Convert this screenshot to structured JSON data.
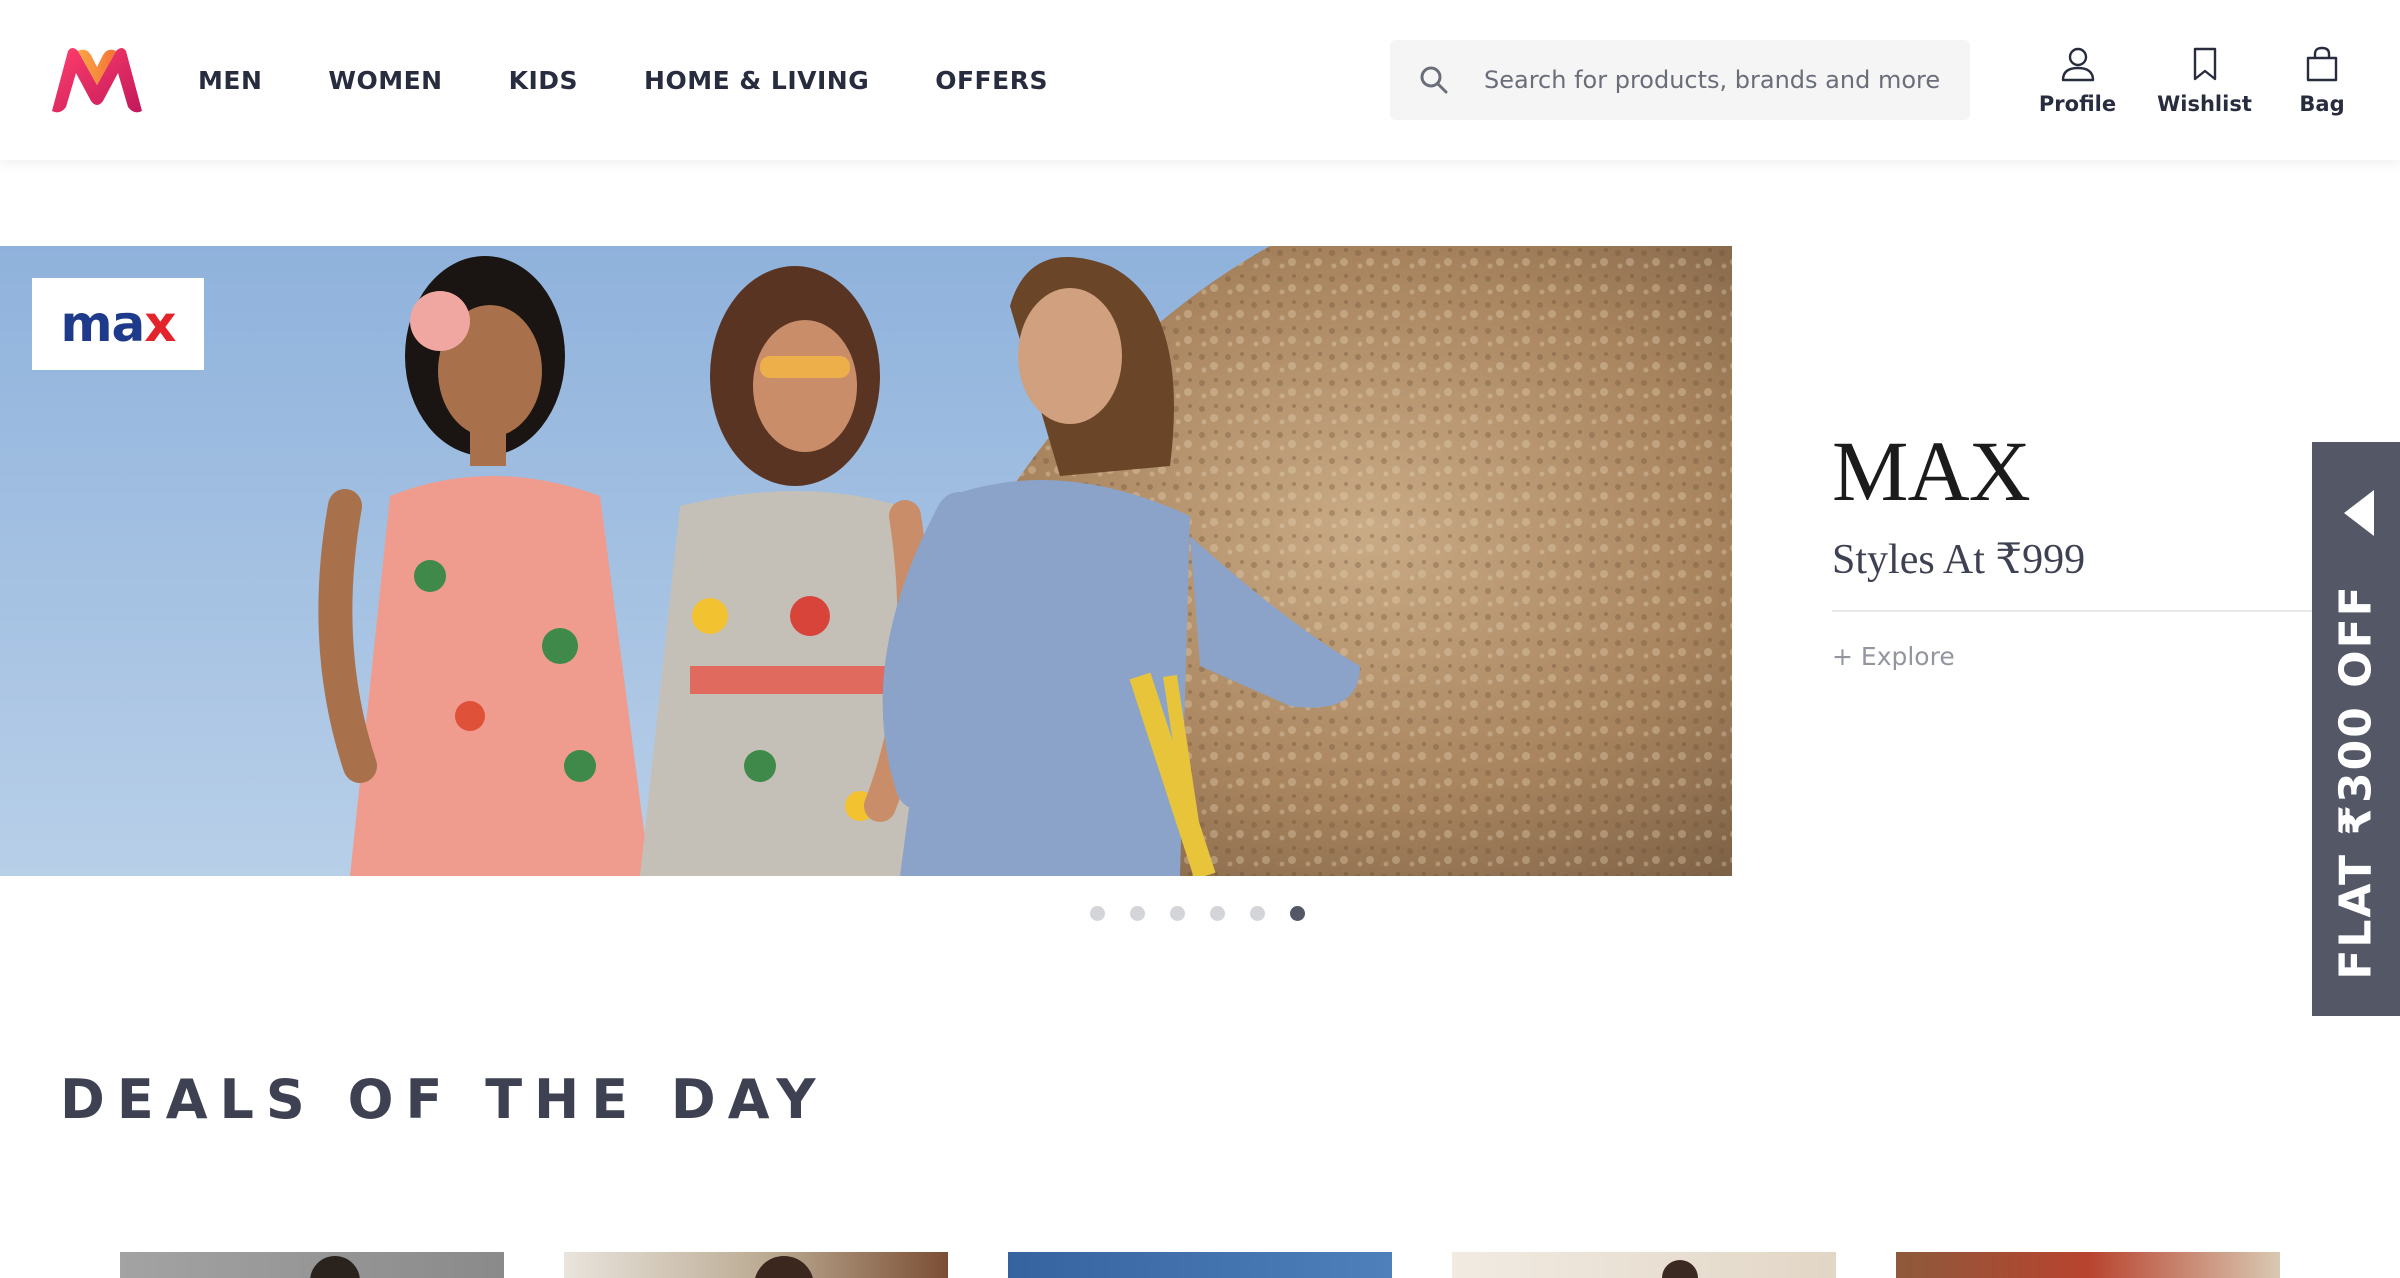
{
  "header": {
    "nav": [
      "MEN",
      "WOMEN",
      "KIDS",
      "HOME & LIVING",
      "OFFERS"
    ],
    "search_placeholder": "Search for products, brands and more",
    "actions": {
      "profile": "Profile",
      "wishlist": "Wishlist",
      "bag": "Bag"
    }
  },
  "banner": {
    "brand_logo_text": "max",
    "title": "MAX",
    "subtitle": "Styles At ₹999",
    "explore": "+ Explore",
    "slides_total": 6,
    "active_slide": 6
  },
  "side_tab": {
    "text": "FLAT ₹300 OFF"
  },
  "deals": {
    "title": "DEALS OF THE DAY",
    "card_colors": [
      "#9a9a9a",
      "#bdb3a6",
      "#3f6ea3",
      "#e6dccf",
      "#8d5a3b"
    ]
  },
  "colors": {
    "brand_pink": "#ff3f6c",
    "brand_orange": "#f9a23b",
    "text": "#282c3f",
    "tab": "#535766"
  }
}
